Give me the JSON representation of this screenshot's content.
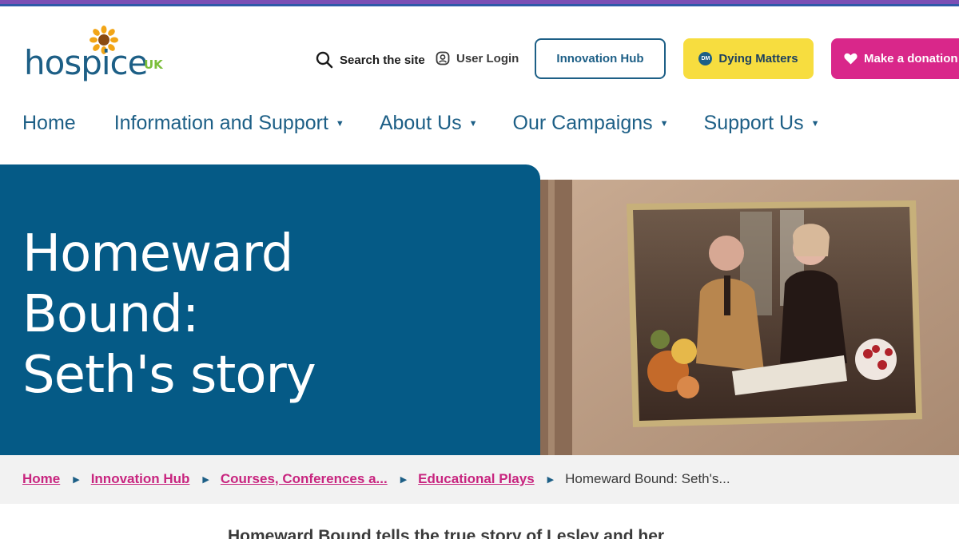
{
  "brand": {
    "logo_text": "hospice",
    "logo_suffix": "UK",
    "accent_blue": "#1d5f86",
    "accent_pink": "#d9278a",
    "accent_yellow": "#f7dd3f",
    "hero_blue": "#055a86"
  },
  "utility": {
    "search_label": "Search the site",
    "login_label": "User Login",
    "innovation_hub_label": "Innovation Hub",
    "dying_matters_label": "Dying Matters",
    "dying_matters_badge": "DM",
    "donate_label": "Make a donation"
  },
  "nav": {
    "items": [
      {
        "label": "Home",
        "has_dropdown": false
      },
      {
        "label": "Information and Support",
        "has_dropdown": true
      },
      {
        "label": "About Us",
        "has_dropdown": true
      },
      {
        "label": "Our Campaigns",
        "has_dropdown": true
      },
      {
        "label": "Support Us",
        "has_dropdown": true
      }
    ]
  },
  "hero": {
    "title": "Homeward Bound: Seth's story"
  },
  "breadcrumb": {
    "items": [
      {
        "label": "Home"
      },
      {
        "label": "Innovation Hub"
      },
      {
        "label": "Courses, Conferences a..."
      },
      {
        "label": "Educational Plays"
      }
    ],
    "current": "Homeward Bound: Seth's..."
  },
  "intro_text": "Homeward Bound tells the true story of Lesley and her"
}
